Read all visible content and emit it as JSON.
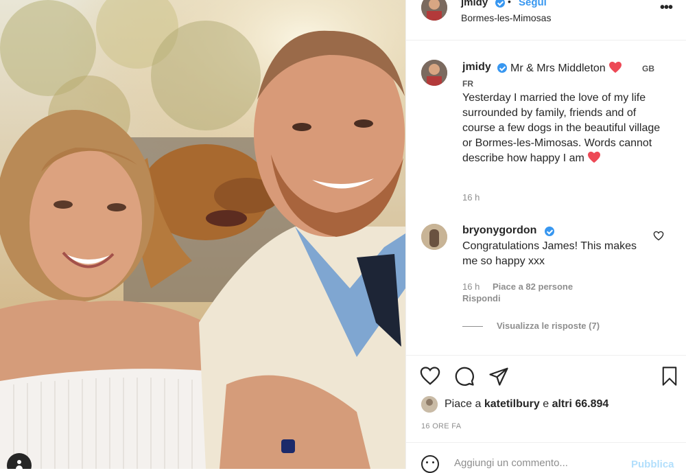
{
  "post": {
    "header": {
      "username": "jmidy",
      "follow_label": "Segui",
      "separator": "•",
      "location": "Bormes-les-Mimosas",
      "more_label": "•••"
    },
    "caption": {
      "username": "jmidy",
      "title": "Mr & Mrs Middleton",
      "flag_gb": "GB",
      "flag_fr": "FR",
      "body": "Yesterday I married the love of my life surrounded by family, friends and of course a few dogs in the beautiful village or Bormes-les-Mimosas. Words cannot describe how happy I am",
      "time": "16 h"
    },
    "comment": {
      "username": "bryonygordon",
      "text": "Congratulations James! This makes me so happy xxx",
      "time": "16 h",
      "likes": "Piace a 82 persone",
      "reply_label": "Rispondi",
      "view_replies": "Visualizza le risposte (7)"
    },
    "likes": {
      "prefix": "Piace a",
      "user": "katetilbury",
      "conj": "e",
      "others": "altri 66.894"
    },
    "timestamp": "16 ORE FA",
    "comment_box": {
      "placeholder": "Aggiungi un commento...",
      "publish_label": "Pubblica"
    }
  },
  "colors": {
    "link_blue": "#3897f0",
    "heart_red": "#ed4956",
    "publish_disabled": "#b2dffc",
    "muted": "#8e8e8e"
  },
  "icons": {
    "like": "heart-outline-icon",
    "comment": "speech-bubble-icon",
    "share": "paper-plane-icon",
    "save": "bookmark-icon",
    "emoji": "smiley-icon",
    "verified": "verified-badge-icon"
  }
}
